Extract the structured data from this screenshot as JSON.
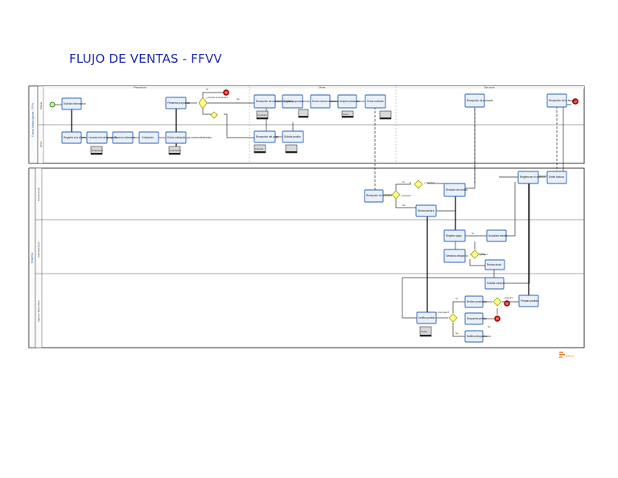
{
  "title": "FLUJO DE VENTAS - FFVV",
  "pools": {
    "top": {
      "name": "Fuerza Ventas Agente - FFVV",
      "lanes": [
        "Cliente",
        "FFVV"
      ],
      "phases": [
        "Preparación",
        "Oferta",
        "Ejecución"
      ]
    },
    "bottom": {
      "name": "Empresa",
      "lanes": [
        "Operaciones",
        "Administración",
        "Agente / Back office"
      ]
    }
  },
  "tasks": [
    {
      "id": "t1",
      "label": "Solicita información"
    },
    {
      "id": "t2",
      "label": "Registra a la cliente"
    },
    {
      "id": "t3",
      "label": "Levanta info del proyecto"
    },
    {
      "id": "t4",
      "label": "Genera cotización"
    },
    {
      "id": "t5",
      "label": "Cotización"
    },
    {
      "id": "t6",
      "label": "Presenta propuesta"
    },
    {
      "id": "t7",
      "label": "Envía cotización por correo electrónico"
    },
    {
      "id": "t8",
      "label": "Recepción de solicitud de ajuste"
    },
    {
      "id": "t9",
      "label": "Ajusta propuesta"
    },
    {
      "id": "t10",
      "label": "Envía nueva cotización"
    },
    {
      "id": "t11",
      "label": "Acepta cotización"
    },
    {
      "id": "t12",
      "label": "Firma contrato"
    },
    {
      "id": "t13",
      "label": "Recepción del pago"
    },
    {
      "id": "t14",
      "label": "Solicita pedido"
    },
    {
      "id": "t15",
      "label": "Recepción de producto"
    },
    {
      "id": "t16",
      "label": "Recepción de la factura"
    },
    {
      "id": "t17",
      "label": "Recepción de solicitud"
    },
    {
      "id": "t18",
      "label": "Revisión de crédito"
    },
    {
      "id": "t19",
      "label": "Revisa factura"
    },
    {
      "id": "t20",
      "label": "Registra en el sistema"
    },
    {
      "id": "t21",
      "label": "Emite factura"
    },
    {
      "id": "t22",
      "label": "Registra pago"
    },
    {
      "id": "t23",
      "label": "Actualiza estado"
    },
    {
      "id": "t24",
      "label": "Gestiona despacho"
    },
    {
      "id": "t25",
      "label": "Revisa stock"
    },
    {
      "id": "t26",
      "label": "Solicita compra"
    },
    {
      "id": "t27",
      "label": "Recibe productos"
    },
    {
      "id": "t28",
      "label": "Prepara pedido"
    },
    {
      "id": "t29",
      "label": "Verifica pedido"
    },
    {
      "id": "t30",
      "label": "Despacha pedido"
    },
    {
      "id": "t31",
      "label": "Notifica despacho"
    }
  ],
  "gateways": [
    {
      "id": "g1",
      "label": "¿Acepta propuesta?"
    },
    {
      "id": "g2",
      "label": "¿Acepta?"
    },
    {
      "id": "g3",
      "label": "¿Crédito?"
    },
    {
      "id": "g4",
      "label": "¿Pago?"
    },
    {
      "id": "g5",
      "label": "¿Stock?"
    },
    {
      "id": "g6",
      "label": "¿Completo?"
    }
  ],
  "flow_labels": {
    "yes": "Sí",
    "no": "No"
  },
  "documents": [
    "Propuesta",
    "Cotización",
    "Contrato",
    "Factura",
    "Guía",
    "Orden"
  ],
  "logo_text": "FFVV"
}
